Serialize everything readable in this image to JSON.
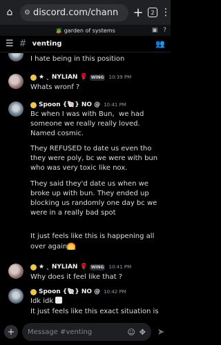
{
  "browser": {
    "url": "discord.com/chann",
    "tab_count": "2",
    "icons": {
      "home": "home-icon",
      "tune": "tune-icon",
      "new_tab": "plus-icon",
      "more": "more-vertical-icon"
    }
  },
  "server": {
    "name": "🪴 garden of systems"
  },
  "channel": {
    "name": "venting"
  },
  "messages": [
    {
      "type": "reply",
      "author": "Spoon",
      "text": "I hate being in this position"
    },
    {
      "author": "★ ˎ NYLIAN",
      "tag": "WING",
      "time": "10:39 PM",
      "text": "Whats wronf ?"
    },
    {
      "author": "Spoon",
      "tag_text": "{🐚} NO @",
      "time": "10:41 PM",
      "paragraphs": [
        "Bc when I was with Bun,  we had someone we really really loved. Named cosmic.",
        "They REFUSED to date us even tho they were poly, bc we were with bun who was very toxic like nox.",
        "They said they'd date us when we broke up with bun. They ended up blocking us randomly one day bc we were in a really bad spot",
        "It just feels like this is happening all over again"
      ]
    },
    {
      "author": "★ ˎ NYLIAN",
      "tag": "WING",
      "time": "10:41 PM",
      "text": "Why does it feel like that ?"
    },
    {
      "author": "Spoon",
      "tag_text": "{🐚} NO @",
      "time": "10:42 PM",
      "lines": [
        "Idk idk",
        "It just feels like this exact situation is"
      ]
    }
  ],
  "composer": {
    "placeholder": "Message #venting"
  }
}
